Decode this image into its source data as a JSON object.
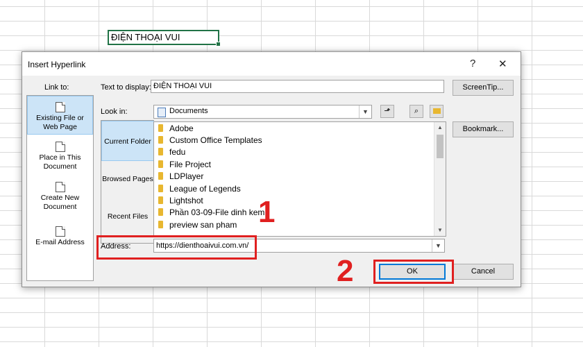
{
  "sheet": {
    "selected_cell_value": "ĐIỆN THOẠI VUI"
  },
  "dialog": {
    "title": "Insert Hyperlink",
    "help_label": "?",
    "close_label": "✕",
    "link_to_label": "Link to:",
    "link_to_items": [
      {
        "label_line1": "Existing File or",
        "label_line2": "Web Page"
      },
      {
        "label_line1": "Place in This",
        "label_line2": "Document"
      },
      {
        "label_line1": "Create New",
        "label_line2": "Document"
      },
      {
        "label_line1": "E-mail Address",
        "label_line2": ""
      }
    ],
    "text_to_display_label": "Text to display:",
    "text_to_display_value": "ĐIỆN THOẠI VUI",
    "screentip_label": "ScreenTip...",
    "look_in_label": "Look in:",
    "look_in_value": "Documents",
    "bookmark_label": "Bookmark...",
    "side_tabs": [
      {
        "label": "Current Folder"
      },
      {
        "label": "Browsed Pages"
      },
      {
        "label": "Recent Files"
      }
    ],
    "files": [
      "Adobe",
      "Custom Office Templates",
      "fedu",
      "File Project",
      "LDPlayer",
      "League of Legends",
      "Lightshot",
      "Phần 03-09-File dinh kem",
      "preview san pham"
    ],
    "address_label": "Address:",
    "address_value": "https://dienthoaivui.com.vn/",
    "ok_label": "OK",
    "cancel_label": "Cancel"
  },
  "annotations": {
    "step1": "1",
    "step2": "2",
    "color": "#e02020"
  },
  "watermark": "Bookmark..."
}
